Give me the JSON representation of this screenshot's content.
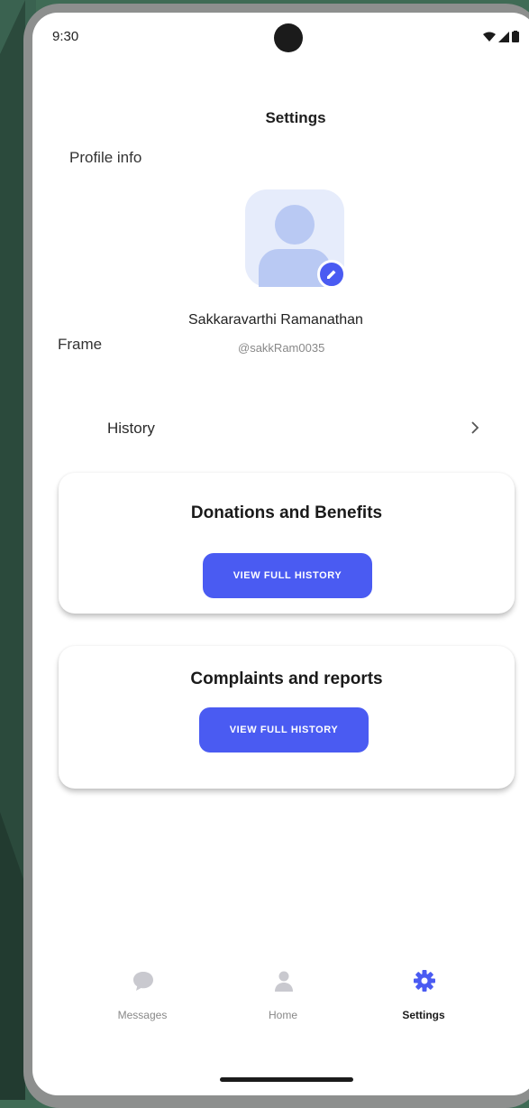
{
  "status_bar": {
    "time": "9:30"
  },
  "page": {
    "title": "Settings"
  },
  "profile": {
    "section_label": "Profile info",
    "name": "Sakkaravarthi Ramanathan",
    "handle": "@sakkRam0035",
    "frame_label": "Frame"
  },
  "history": {
    "label": "History"
  },
  "cards": [
    {
      "title": "Donations  and Benefits",
      "button_label": "VIEW FULL HISTORY"
    },
    {
      "title": "Complaints and reports",
      "button_label": "VIEW FULL HISTORY"
    }
  ],
  "nav": {
    "items": [
      {
        "label": "Messages",
        "icon": "chat-bubble-icon",
        "active": false
      },
      {
        "label": "Home",
        "icon": "person-icon",
        "active": false
      },
      {
        "label": "Settings",
        "icon": "gear-icon",
        "active": true
      }
    ]
  },
  "colors": {
    "accent": "#4a5bf2",
    "avatar_bg": "#e6ecfb",
    "background": "#3f6b55"
  }
}
